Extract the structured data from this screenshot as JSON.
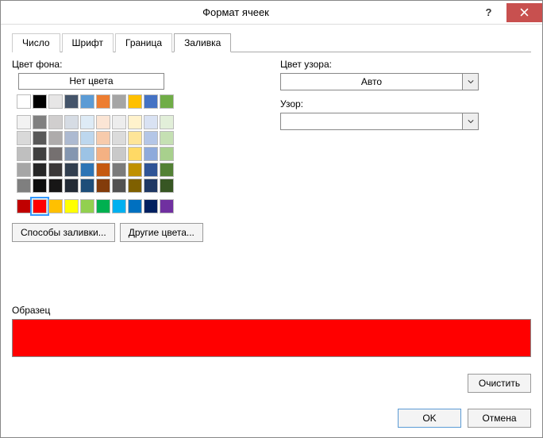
{
  "title": "Формат ячеек",
  "tabs": {
    "number": "Число",
    "font": "Шрифт",
    "border": "Граница",
    "fill": "Заливка"
  },
  "fill": {
    "bg_color_label": "Цвет фона:",
    "no_color": "Нет цвета",
    "fill_effects": "Способы заливки...",
    "more_colors": "Другие цвета...",
    "pattern_color_label": "Цвет узора:",
    "pattern_color_value": "Авто",
    "pattern_style_label": "Узор:",
    "preview_label": "Образец",
    "preview_color": "#ff0000",
    "theme_row1": [
      "#ffffff",
      "#000000",
      "#e7e6e6",
      "#44546a",
      "#5b9bd5",
      "#ed7d31",
      "#a5a5a5",
      "#ffc000",
      "#4472c4",
      "#70ad47"
    ],
    "theme_grid": [
      [
        "#f2f2f2",
        "#808080",
        "#d0cece",
        "#d6dce4",
        "#deebf6",
        "#fbe5d5",
        "#ededed",
        "#fff2cc",
        "#d9e2f3",
        "#e2efd9"
      ],
      [
        "#d9d9d9",
        "#595959",
        "#aeabab",
        "#adbad1",
        "#bdd7ee",
        "#f7cbac",
        "#dbdbdb",
        "#fee599",
        "#b4c6e7",
        "#c5e0b3"
      ],
      [
        "#bfbfbf",
        "#404040",
        "#757070",
        "#8496b0",
        "#9cc3e5",
        "#f4b183",
        "#c9c9c9",
        "#ffd965",
        "#8eaadb",
        "#a8d08d"
      ],
      [
        "#a6a6a6",
        "#262626",
        "#3b3838",
        "#323f4f",
        "#2e75b5",
        "#c55a11",
        "#7b7b7b",
        "#bf9000",
        "#2f5496",
        "#538135"
      ],
      [
        "#7f7f7f",
        "#0d0d0d",
        "#171616",
        "#222a35",
        "#1e4e79",
        "#833c0b",
        "#525252",
        "#7f6000",
        "#1f3864",
        "#375623"
      ]
    ],
    "standard": [
      "#c00000",
      "#ff0000",
      "#ffc000",
      "#ffff00",
      "#92d050",
      "#00b050",
      "#00b0f0",
      "#0070c0",
      "#002060",
      "#7030a0"
    ],
    "selected_standard_index": 1
  },
  "buttons": {
    "clear": "Очистить",
    "ok": "OK",
    "cancel": "Отмена"
  }
}
